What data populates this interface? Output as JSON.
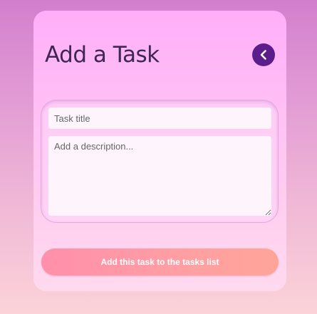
{
  "card": {
    "title": "Add a Task",
    "back_icon": "chevron-left-icon"
  },
  "form": {
    "task_title_placeholder": "Task title",
    "task_title_value": "",
    "description_placeholder": "Add a description...",
    "description_value": "",
    "submit_label": "Add this task to the tasks list"
  },
  "colors": {
    "accent": "#5c1c8c",
    "button_start": "#ff8fab",
    "button_end": "#ffa598",
    "title_text": "#3d2754"
  }
}
